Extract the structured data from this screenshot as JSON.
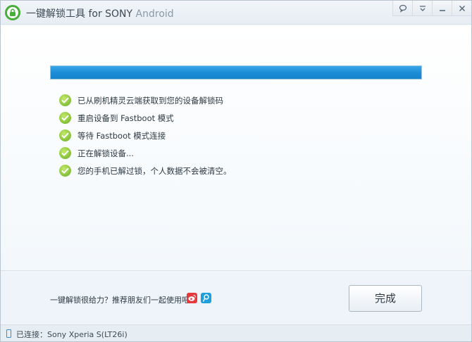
{
  "window": {
    "title": "一键解锁工具 for SONY",
    "title_suffix": " Android",
    "controls": [
      "feedback-icon",
      "menu-icon",
      "minimize-icon",
      "close-icon"
    ]
  },
  "progress": {
    "percent": 100,
    "color": "#1a8bd6"
  },
  "steps": [
    {
      "label": "已从刷机精灵云端获取到您的设备解锁码",
      "icon": "check-icon"
    },
    {
      "label": "重启设备到 Fastboot 模式",
      "icon": "check-icon"
    },
    {
      "label": "等待 Fastboot 模式连接",
      "icon": "check-icon"
    },
    {
      "label": "正在解锁设备...",
      "icon": "check-icon"
    },
    {
      "label": "您的手机已解过锁，个人数据不会被清空。",
      "icon": "check-icon"
    }
  ],
  "footer": {
    "share_text": "一键解锁很给力？推荐朋友们一起使用吧！",
    "share_icons": [
      "weibo-icon",
      "tencent-weibo-icon"
    ],
    "done_label": "完成"
  },
  "status": {
    "text": "已连接：Sony Xperia S(LT26i)",
    "icon": "phone-icon"
  },
  "colors": {
    "accent": "#1a8bd6",
    "success": "#8cc63e",
    "logo": "#48ae3a"
  }
}
